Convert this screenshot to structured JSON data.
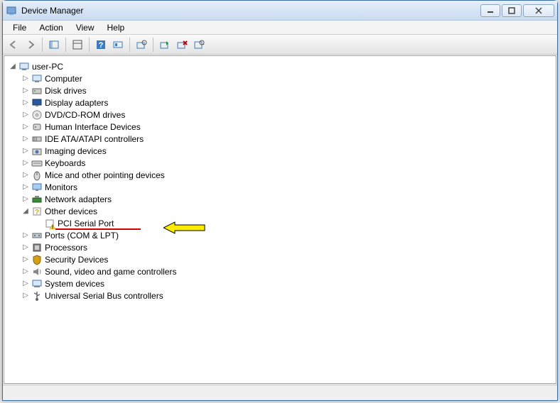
{
  "window": {
    "title": "Device Manager"
  },
  "menubar": {
    "file": "File",
    "action": "Action",
    "view": "View",
    "help": "Help"
  },
  "tree": {
    "root": "user-PC",
    "categories": [
      {
        "label": "Computer",
        "icon": "computer"
      },
      {
        "label": "Disk drives",
        "icon": "disk"
      },
      {
        "label": "Display adapters",
        "icon": "display"
      },
      {
        "label": "DVD/CD-ROM drives",
        "icon": "dvd"
      },
      {
        "label": "Human Interface Devices",
        "icon": "hid"
      },
      {
        "label": "IDE ATA/ATAPI controllers",
        "icon": "ide"
      },
      {
        "label": "Imaging devices",
        "icon": "imaging"
      },
      {
        "label": "Keyboards",
        "icon": "keyboard"
      },
      {
        "label": "Mice and other pointing devices",
        "icon": "mouse"
      },
      {
        "label": "Monitors",
        "icon": "monitor"
      },
      {
        "label": "Network adapters",
        "icon": "network"
      }
    ],
    "other_devices": {
      "label": "Other devices",
      "children": [
        {
          "label": "PCI Serial Port",
          "warning": true
        }
      ]
    },
    "categories2": [
      {
        "label": "Ports (COM & LPT)",
        "icon": "ports"
      },
      {
        "label": "Processors",
        "icon": "cpu"
      },
      {
        "label": "Security Devices",
        "icon": "security"
      },
      {
        "label": "Sound, video and game controllers",
        "icon": "sound"
      },
      {
        "label": "System devices",
        "icon": "system"
      },
      {
        "label": "Universal Serial Bus controllers",
        "icon": "usb"
      }
    ]
  }
}
